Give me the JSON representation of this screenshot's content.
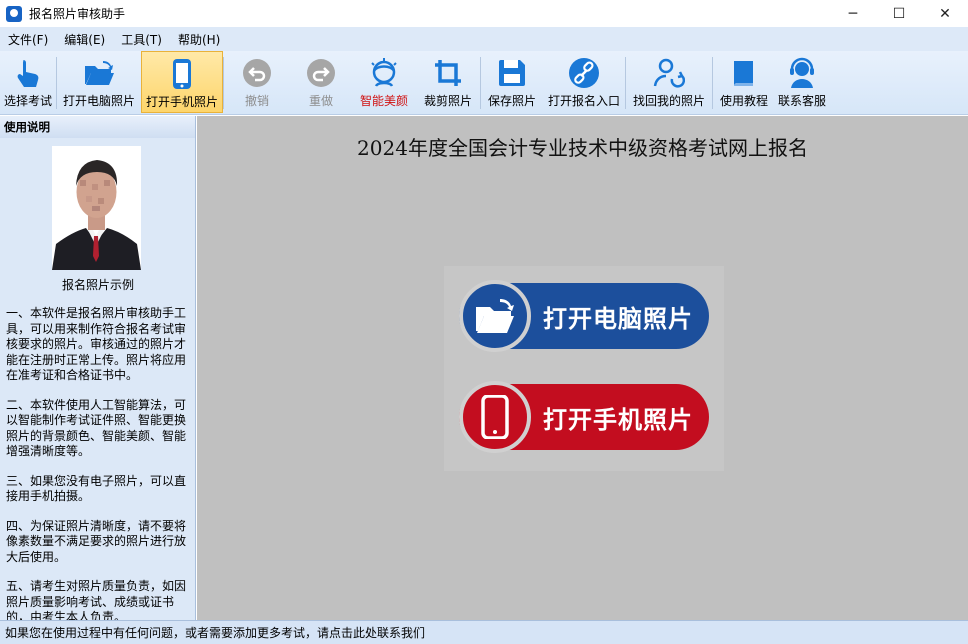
{
  "window": {
    "title": "报名照片审核助手",
    "controls": [
      "─",
      "☐",
      "✕"
    ]
  },
  "menu": [
    {
      "label": "文件(F)"
    },
    {
      "label": "编辑(E)"
    },
    {
      "label": "工具(T)"
    },
    {
      "label": "帮助(H)"
    }
  ],
  "toolbar": {
    "select_exam": "选择考试",
    "open_pc_photo": "打开电脑照片",
    "open_phone_photo": "打开手机照片",
    "undo": "撤销",
    "redo": "重做",
    "beautify": "智能美颜",
    "crop": "裁剪照片",
    "save": "保存照片",
    "open_entry": "打开报名入口",
    "retrieve": "找回我的照片",
    "tutorial": "使用教程",
    "support": "联系客服",
    "active_item": "打开手机照片",
    "disabled_items": [
      "撤销",
      "重做"
    ]
  },
  "left_panel": {
    "heading": "使用说明",
    "photo_caption": "报名照片示例",
    "notes": [
      "一、本软件是报名照片审核助手工具，可以用来制作符合报名考试审核要求的照片。审核通过的照片才能在注册时正常上传。照片将应用在准考证和合格证书中。",
      "二、本软件使用人工智能算法，可以智能制作考试证件照、智能更换照片的背景颜色、智能美颜、智能增强清晰度等。",
      "三、如果您没有电子照片，可以直接用手机拍摄。",
      "四、为保证照片清晰度，请不要将像素数量不满足要求的照片进行放大后使用。",
      "五、请考生对照片质量负责，如因照片质量影响考试、成绩或证书的，由考生本人负责。"
    ]
  },
  "main": {
    "exam_title": "2024年度全国会计专业技术中级资格考试网上报名",
    "btn_open_pc": "打开电脑照片",
    "btn_open_phone": "打开手机照片"
  },
  "status": {
    "text": "如果您在使用过程中有任何问题，或者需要添加更多考试，请点击此处联系我们"
  },
  "colors": {
    "accent_blue": "#1763c4",
    "button_blue": "#1c4f9c",
    "button_red": "#c30d1f",
    "beautify_red": "#d01010",
    "active_yellow": "#fdd56c"
  }
}
